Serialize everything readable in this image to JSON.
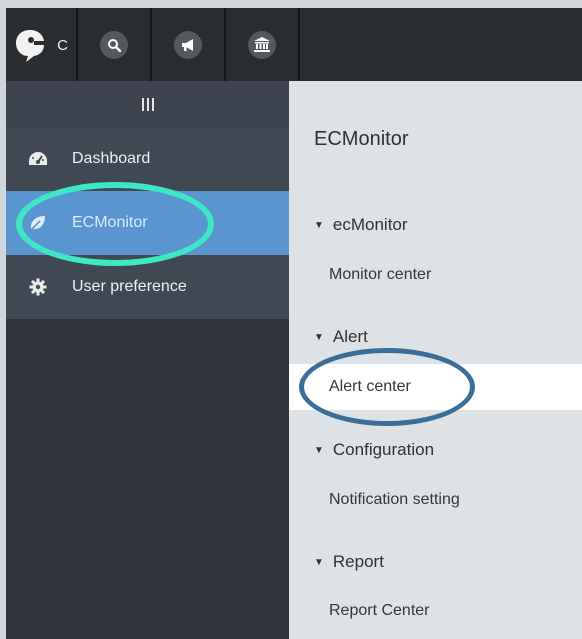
{
  "topbar": {
    "logo_text": "C",
    "buttons": [
      {
        "icon": "search-icon"
      },
      {
        "icon": "megaphone-icon"
      },
      {
        "icon": "bank-icon"
      }
    ]
  },
  "sidebar": {
    "toggle_icon": "bars-icon",
    "items": [
      {
        "label": "Dashboard",
        "icon": "dashboard-icon"
      },
      {
        "label": "ECMonitor",
        "icon": "leaf-icon",
        "active": true
      },
      {
        "label": "User preference",
        "icon": "gear-icon"
      }
    ]
  },
  "panel": {
    "title": "ECMonitor",
    "sections": [
      {
        "label": "ecMonitor",
        "links": [
          "Monitor center"
        ]
      },
      {
        "label": "Alert",
        "links": [
          "Alert center"
        ]
      },
      {
        "label": "Configuration",
        "links": [
          "Notification setting"
        ]
      },
      {
        "label": "Report",
        "links": [
          "Report Center"
        ]
      }
    ],
    "selected_link": "Alert center"
  },
  "annotations": {
    "sidebar_ring_color": "#3fe8c4",
    "panel_ring_color": "#3a6e98"
  },
  "colors": {
    "topbar": "#2a2d30",
    "sidebar_active": "#5a95cf",
    "panel_bg": "#dde2e6"
  }
}
